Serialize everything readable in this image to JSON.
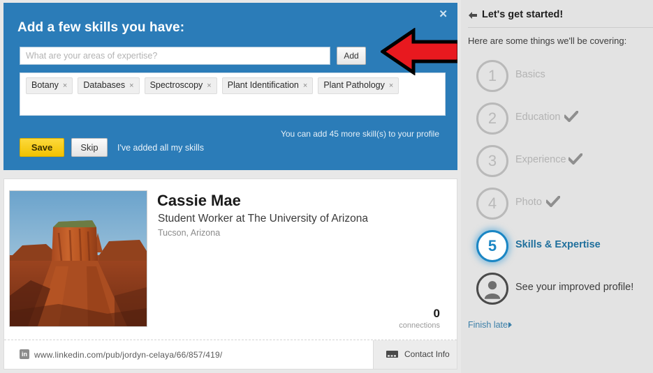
{
  "skills_panel": {
    "title": "Add a few skills you have:",
    "close_label": "✕",
    "input_placeholder": "What are your areas of expertise?",
    "input_value": "",
    "add_button": "Add",
    "tags": [
      {
        "label": "Botany",
        "remove": "×"
      },
      {
        "label": "Databases",
        "remove": "×"
      },
      {
        "label": "Spectroscopy",
        "remove": "×"
      },
      {
        "label": "Plant Identification",
        "remove": "×"
      },
      {
        "label": "Plant Pathology",
        "remove": "×"
      }
    ],
    "quota_note": "You can add 45 more skill(s) to your profile",
    "save_button": "Save",
    "skip_button": "Skip",
    "added_all_link": "I've added all my skills",
    "panel_color": "#2b7cb8",
    "save_color": "#f2c200",
    "annotation_arrow": {
      "name": "red-left-arrow",
      "color": "#e8191f",
      "outline": "#000000"
    }
  },
  "profile": {
    "name": "Cassie Mae",
    "headline": "Student Worker at The University of Arizona",
    "location": "Tucson, Arizona",
    "connections_count": "0",
    "connections_label": "connections",
    "photo_alt": "desert butte landscape photo",
    "url": "www.linkedin.com/pub/jordyn-celaya/66/857/419/",
    "linkedin_mark": "in",
    "contact_info_button": "Contact Info"
  },
  "sidebar": {
    "header": "Let's get started!",
    "subheader": "Here are some things we'll be covering:",
    "steps": [
      {
        "number": "1",
        "label": "Basics",
        "done": false,
        "active": false
      },
      {
        "number": "2",
        "label": "Education",
        "done": true,
        "active": false
      },
      {
        "number": "3",
        "label": "Experience",
        "done": true,
        "active": false
      },
      {
        "number": "4",
        "label": "Photo",
        "done": true,
        "active": false
      },
      {
        "number": "5",
        "label": "Skills & Expertise",
        "done": false,
        "active": true
      }
    ],
    "final_step_label": "See your improved profile!",
    "finish_later": "Finish later",
    "accent_color": "#1b86c4",
    "link_color": "#3b7fa8"
  }
}
